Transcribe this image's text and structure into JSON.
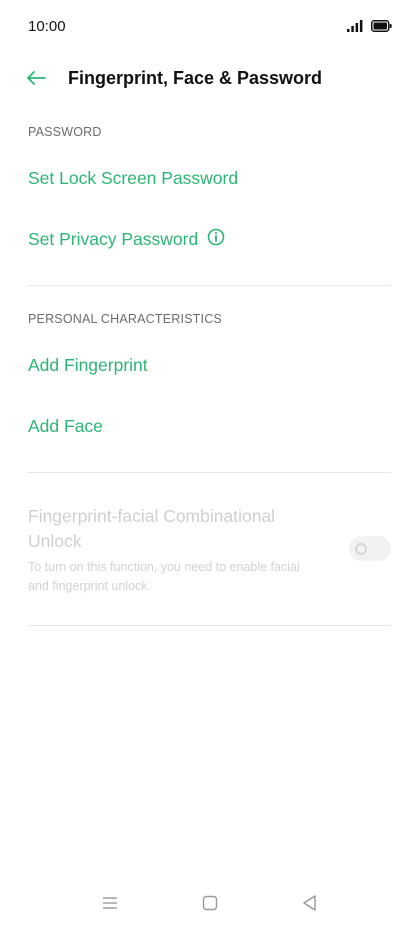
{
  "status_bar": {
    "time": "10:00",
    "icons": [
      "signal-icon",
      "battery-icon"
    ]
  },
  "header": {
    "title": "Fingerprint, Face & Password",
    "back_icon": "back-arrow-icon"
  },
  "sections": {
    "password": {
      "header": "PASSWORD",
      "items": [
        {
          "label": "Set Lock Screen Password"
        },
        {
          "label": "Set Privacy Password",
          "icon": "info-icon"
        }
      ]
    },
    "personal": {
      "header": "PERSONAL CHARACTERISTICS",
      "items": [
        {
          "label": "Add Fingerprint"
        },
        {
          "label": "Add Face"
        }
      ]
    }
  },
  "combo_unlock": {
    "title": "Fingerprint-facial Combinational Unlock",
    "description": "To turn on this function, you need to enable facial and fingerprint unlock.",
    "enabled": false,
    "toggle_on": false
  },
  "nav_bar": {
    "icons": [
      "menu-icon",
      "home-icon",
      "back-icon"
    ]
  },
  "colors": {
    "accent": "#2bb673",
    "disabled_text": "#cfcfcf",
    "section_header": "#6b6b6b",
    "divider": "#e6e6e6"
  }
}
